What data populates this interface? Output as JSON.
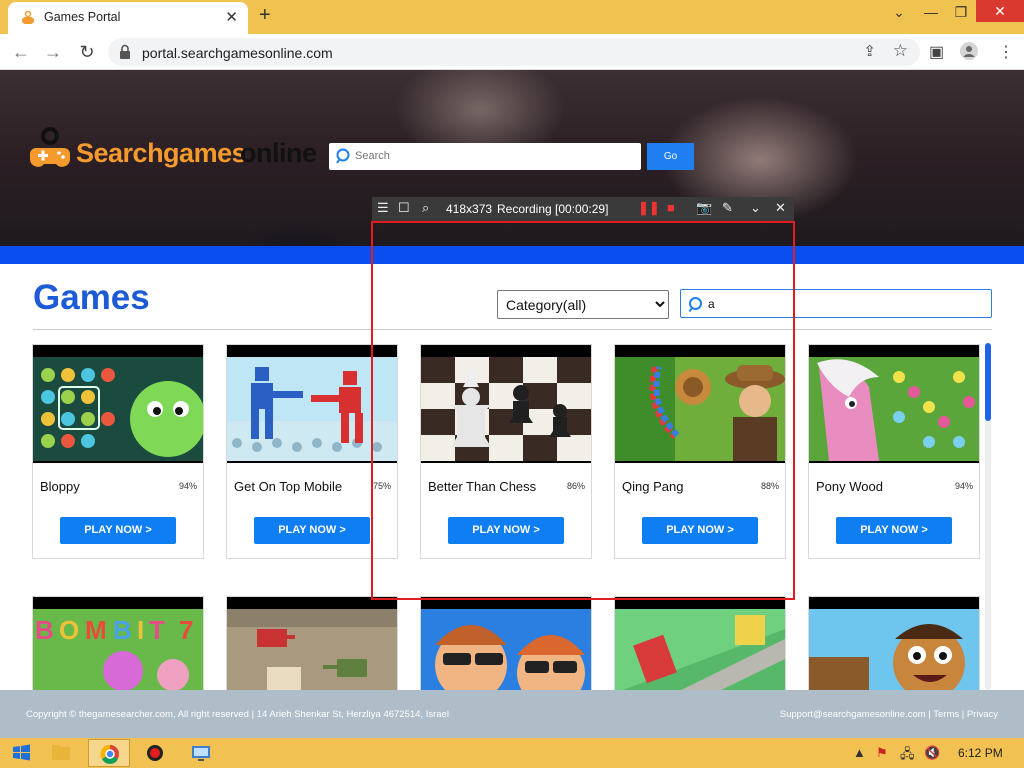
{
  "browser": {
    "tab_title": "Games Portal",
    "new_tab": "+",
    "url": "portal.searchgamesonline.com"
  },
  "site": {
    "logo_part1": "Searchgames",
    "logo_part2": "online",
    "search_placeholder": "Search",
    "go_label": "Go"
  },
  "recorder": {
    "size": "418x373",
    "status": "Recording [00:00:29]"
  },
  "games": {
    "heading": "Games",
    "category_selected": "Category(all)",
    "filter_value": "a",
    "play_label": "PLAY NOW >",
    "cards": [
      {
        "name": "Bloppy",
        "rating": "94%"
      },
      {
        "name": "Get On Top Mobile",
        "rating": "75%"
      },
      {
        "name": "Better Than Chess",
        "rating": "86%"
      },
      {
        "name": "Qing Pang",
        "rating": "88%"
      },
      {
        "name": "Pony Wood",
        "rating": "94%"
      }
    ]
  },
  "footer": {
    "copyright": "Copyright © thegamesearcher.com, All right reserved | 14 Arieh Shenkar St, Herzliya 4672514, Israel",
    "links": "Support@searchgamesonline.com | Terms | Privacy"
  },
  "taskbar": {
    "clock": "6:12 PM"
  },
  "colors": {
    "brand_blue": "#1d5bd6",
    "button_blue": "#0e7ef2",
    "logo_orange": "#f59a2c",
    "record_red": "#e11d1d"
  }
}
